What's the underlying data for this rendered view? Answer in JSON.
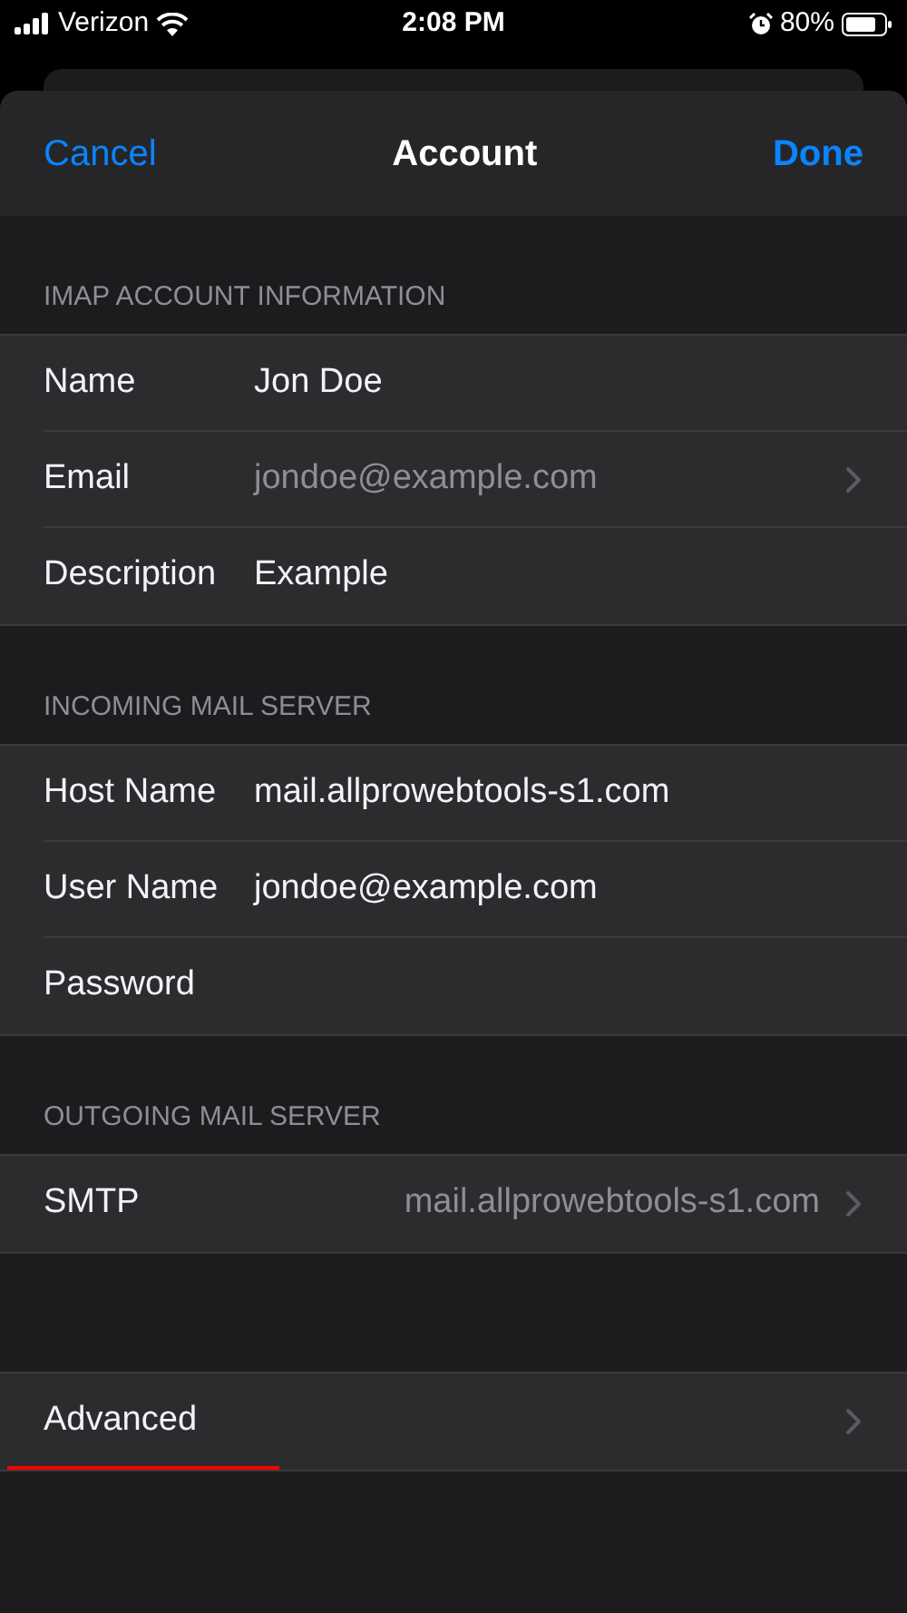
{
  "status_bar": {
    "carrier": "Verizon",
    "time": "2:08 PM",
    "battery": "80%"
  },
  "header": {
    "cancel": "Cancel",
    "title": "Account",
    "done": "Done"
  },
  "sections": [
    {
      "title": "IMAP ACCOUNT INFORMATION",
      "rows": [
        {
          "kind": "field",
          "label": "Name",
          "value": "Jon Doe"
        },
        {
          "kind": "readonly",
          "label": "Email",
          "value": "jondoe@example.com"
        },
        {
          "kind": "field",
          "label": "Description",
          "value": "Example"
        }
      ]
    },
    {
      "title": "INCOMING MAIL SERVER",
      "rows": [
        {
          "kind": "field",
          "label": "Host Name",
          "value": "mail.allprowebtools-s1.com"
        },
        {
          "kind": "field",
          "label": "User Name",
          "value": "jondoe@example.com"
        },
        {
          "kind": "field",
          "label": "Password"
        }
      ]
    },
    {
      "title": "OUTGOING MAIL SERVER",
      "rows": [
        {
          "kind": "link",
          "label": "SMTP",
          "value": "mail.allprowebtools-s1.com"
        }
      ]
    },
    {
      "rows": [
        {
          "kind": "link",
          "label": "Advanced",
          "underlined": true
        }
      ]
    }
  ]
}
